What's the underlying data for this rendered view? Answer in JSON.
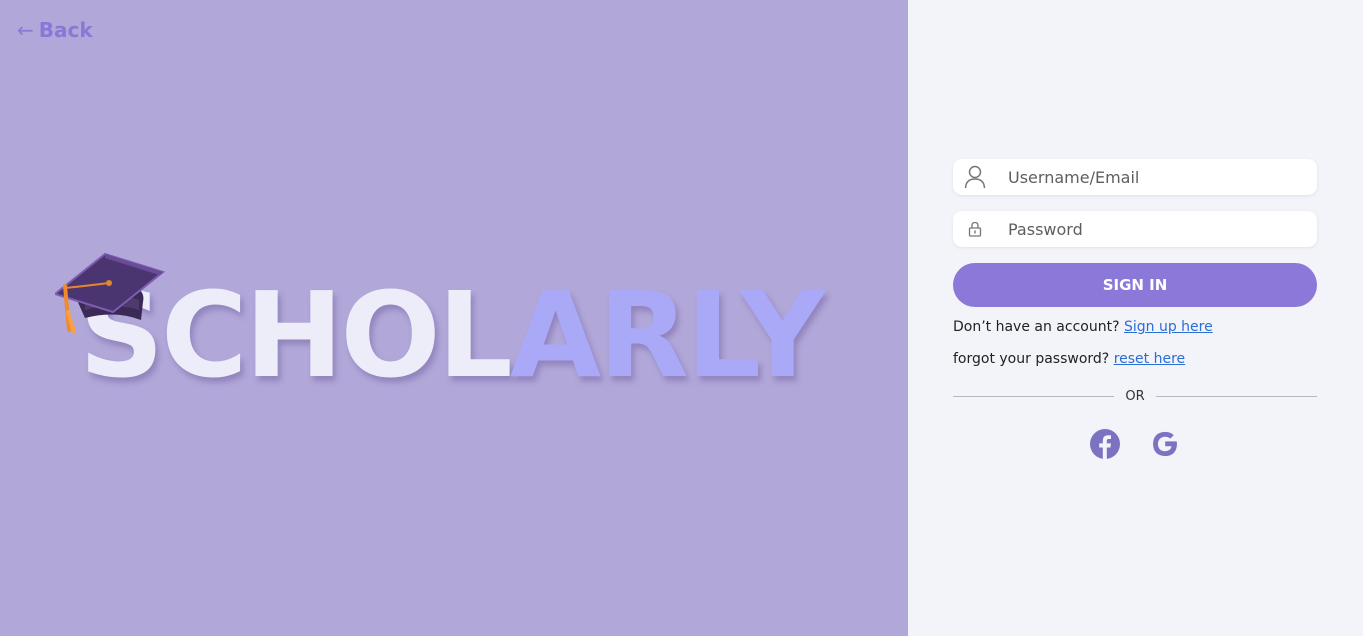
{
  "back": {
    "arrow": "←",
    "label": "Back"
  },
  "logo": {
    "part_light": "SCHOL",
    "part_accent": "ARLY",
    "icon": "graduation-cap-icon"
  },
  "form": {
    "username_placeholder": "Username/Email",
    "password_placeholder": "Password",
    "username_icon": "user-icon",
    "password_icon": "lock-icon",
    "signin_label": "SIGN IN",
    "signup_prompt": "Don’t have an account?",
    "signup_link": "Sign up here",
    "forgot_prompt": "forgot your password?",
    "forgot_link": "reset here",
    "divider_text": "OR"
  },
  "social": {
    "facebook_icon": "facebook-icon",
    "google_icon": "google-icon"
  },
  "colors": {
    "left_bg": "#b1a7d8",
    "right_bg": "#f3f3fa",
    "accent": "#8b78d8",
    "logo_light": "#edecf9",
    "logo_accent": "#a9a9f7",
    "social_icon": "#7b72c2",
    "link": "#2a6ed6"
  }
}
